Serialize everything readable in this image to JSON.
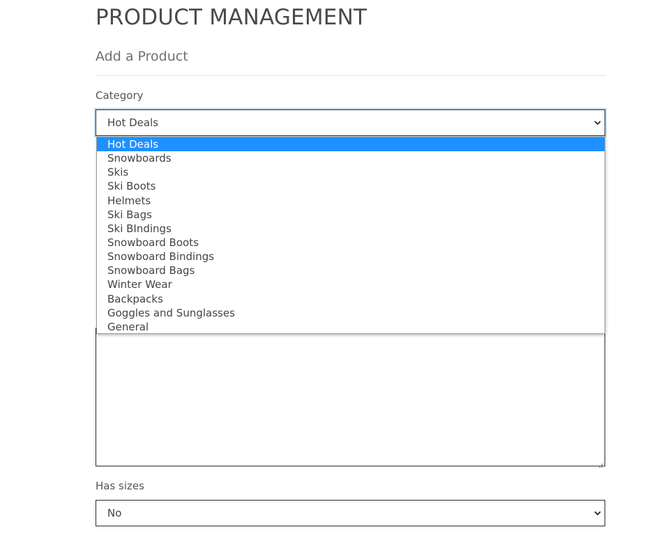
{
  "page": {
    "title": "PRODUCT MANAGEMENT",
    "subtitle": "Add a Product"
  },
  "category": {
    "label": "Category",
    "selected": "Hot Deals",
    "options": [
      "Hot Deals",
      "Snowboards",
      "Skis",
      "Ski Boots",
      "Helmets",
      "Ski Bags",
      "Ski BIndings",
      "Snowboard Boots",
      "Snowboard Bindings",
      "Snowboard Bags",
      "Winter Wear",
      "Backpacks",
      "Goggles and Sunglasses",
      "General"
    ],
    "highlighted_index": 0
  },
  "has_sizes": {
    "label": "Has sizes",
    "selected": "No"
  },
  "icons": {
    "select_arrow": "chevron-down-icon",
    "textarea_grip": "resize-grip-icon"
  },
  "colors": {
    "highlight": "#1e90ff",
    "focus_ring": "#b9d4ef"
  }
}
